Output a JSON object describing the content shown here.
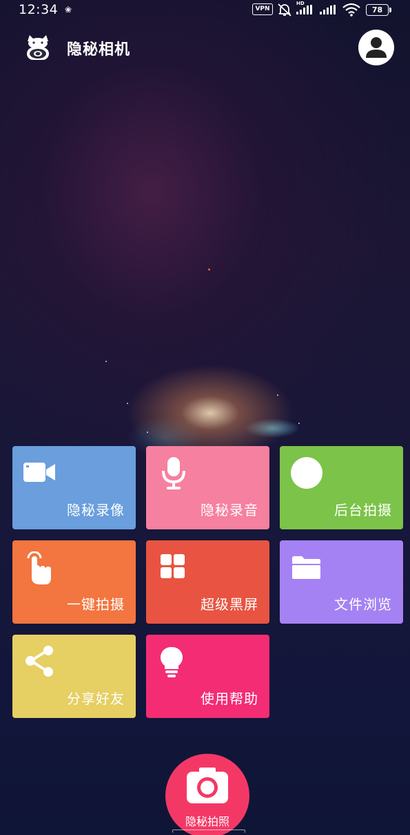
{
  "status_bar": {
    "time": "12:34",
    "vpn": "VPN",
    "hd": "HD",
    "battery": "78"
  },
  "header": {
    "title": "隐秘相机"
  },
  "tiles": [
    {
      "label": "隐秘录像",
      "icon": "video-camera-icon",
      "color": "#6a9edc"
    },
    {
      "label": "隐秘录音",
      "icon": "microphone-icon",
      "color": "#f6809f"
    },
    {
      "label": "后台拍摄",
      "icon": "circle-icon",
      "color": "#7cc349"
    },
    {
      "label": "一键拍摄",
      "icon": "hand-tap-icon",
      "color": "#f3753f"
    },
    {
      "label": "超级黑屏",
      "icon": "grid-icon",
      "color": "#e85441"
    },
    {
      "label": "文件浏览",
      "icon": "folder-icon",
      "color": "#a582f3"
    },
    {
      "label": "分享好友",
      "icon": "share-icon",
      "color": "#e6cf63"
    },
    {
      "label": "使用帮助",
      "icon": "lightbulb-icon",
      "color": "#f42c74"
    }
  ],
  "capture": {
    "label": "隐秘拍照",
    "color": "#f43866"
  }
}
